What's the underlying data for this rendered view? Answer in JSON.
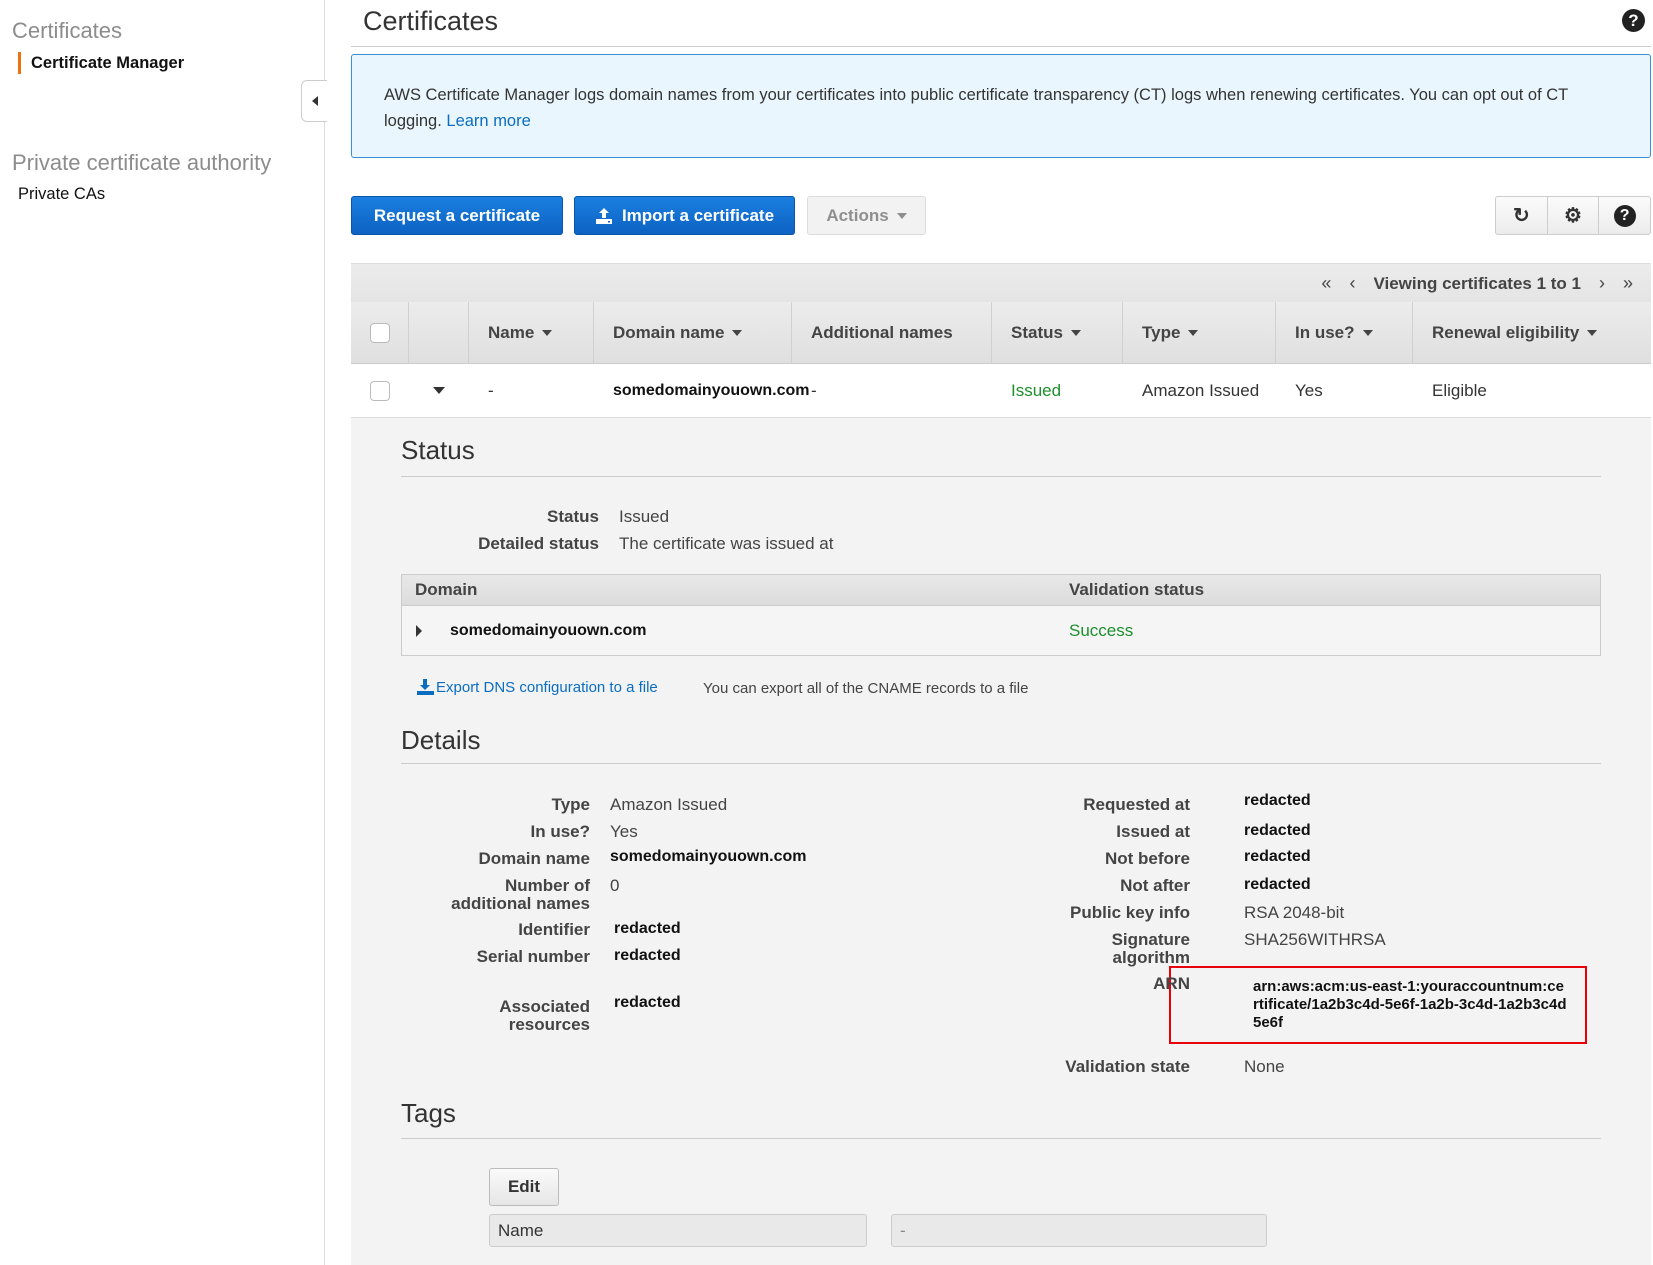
{
  "sidebar": {
    "section1_title": "Certificates",
    "item_certificate_manager": "Certificate Manager",
    "section2_title": "Private certificate authority",
    "item_private_cas": "Private CAs",
    "accent_color": "#ec7211"
  },
  "header": {
    "title": "Certificates",
    "help_icon": "?"
  },
  "info_banner": {
    "text": "AWS Certificate Manager logs domain names from your certificates into public certificate transparency (CT) logs when renewing certificates. You can opt out of CT logging.",
    "link": "Learn more"
  },
  "toolbar": {
    "request_label": "Request a certificate",
    "import_label": "Import a certificate",
    "actions_label": "Actions",
    "refresh_icon": "↻",
    "settings_icon": "⚙",
    "help_icon": "?"
  },
  "table": {
    "pager": {
      "first": "«",
      "prev": "‹",
      "text": "Viewing certificates 1 to 1",
      "next": "›",
      "last": "»"
    },
    "columns": [
      "Name",
      "Domain name",
      "Additional names",
      "Status",
      "Type",
      "In use?",
      "Renewal eligibility"
    ],
    "rows": [
      {
        "name": "-",
        "domain_name": "somedomainyouown.com",
        "additional_names": "-",
        "status": "Issued",
        "type": "Amazon Issued",
        "in_use": "Yes",
        "renewal_eligibility": "Eligible"
      }
    ]
  },
  "detail": {
    "status_section": {
      "title": "Status",
      "status_label": "Status",
      "status_value": "Issued",
      "detailed_label": "Detailed status",
      "detailed_value": "The certificate was issued at",
      "validation_table": {
        "col_domain": "Domain",
        "col_validation": "Validation status",
        "rows": [
          {
            "domain": "somedomainyouown.com",
            "validation_status": "Success"
          }
        ]
      },
      "export_link": "Export DNS configuration to a file",
      "export_note": "You can export all of the CNAME records to a file"
    },
    "details_section": {
      "title": "Details",
      "left": [
        {
          "label": "Type",
          "value": "Amazon Issued"
        },
        {
          "label": "In use?",
          "value": "Yes"
        },
        {
          "label": "Domain name",
          "value": "somedomainyouown.com"
        },
        {
          "label": "Number of additional names",
          "value": "0"
        },
        {
          "label": "Identifier",
          "value": "redacted"
        },
        {
          "label": "Serial number",
          "value": "redacted"
        },
        {
          "label": "Associated resources",
          "value": "redacted"
        }
      ],
      "right": [
        {
          "label": "Requested at",
          "value": "redacted"
        },
        {
          "label": "Issued at",
          "value": "redacted"
        },
        {
          "label": "Not before",
          "value": "redacted"
        },
        {
          "label": "Not after",
          "value": "redacted"
        },
        {
          "label": "Public key info",
          "value": "RSA 2048-bit"
        },
        {
          "label": "Signature algorithm",
          "value": "SHA256WITHRSA"
        },
        {
          "label": "ARN",
          "value": "arn:aws:acm:us-east-1:youraccountnum:certificate/1a2b3c4d-5e6f-1a2b-3c4d-1a2b3c4d5e6f"
        },
        {
          "label": "Validation state",
          "value": "None"
        }
      ],
      "highlight_color": "#e8000b"
    },
    "tags_section": {
      "title": "Tags",
      "edit_label": "Edit",
      "tag_key": "Name",
      "tag_value": "-"
    }
  }
}
